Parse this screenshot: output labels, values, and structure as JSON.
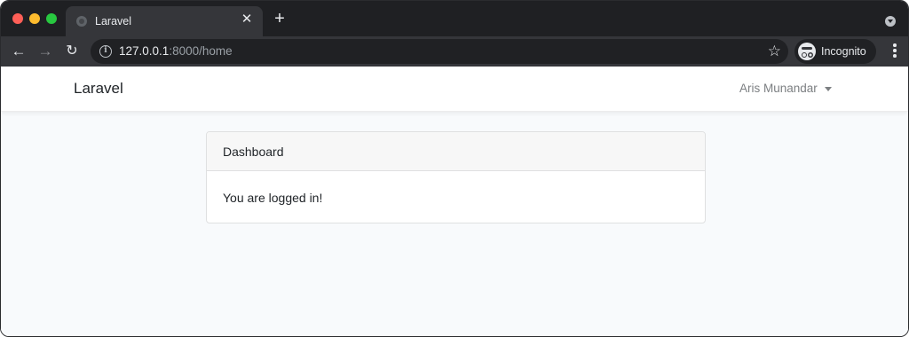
{
  "browser": {
    "tab": {
      "title": "Laravel",
      "favicon": "globe-icon",
      "close_glyph": "✕"
    },
    "new_tab_glyph": "+",
    "address": {
      "host": "127.0.0.1",
      "rest": ":8000/home"
    },
    "profile": {
      "label": "Incognito",
      "icon": "incognito-icon"
    },
    "icons": {
      "back": "←",
      "forward": "→",
      "reload": "↻",
      "info": "i",
      "bookmark": "☆"
    }
  },
  "app": {
    "brand": "Laravel",
    "user_name": "Aris Munandar"
  },
  "card": {
    "header": "Dashboard",
    "body": "You are logged in!"
  },
  "colors": {
    "page_background": "#f8fafc",
    "browser_chrome": "#35363a",
    "tab_strip": "#1f2023"
  }
}
